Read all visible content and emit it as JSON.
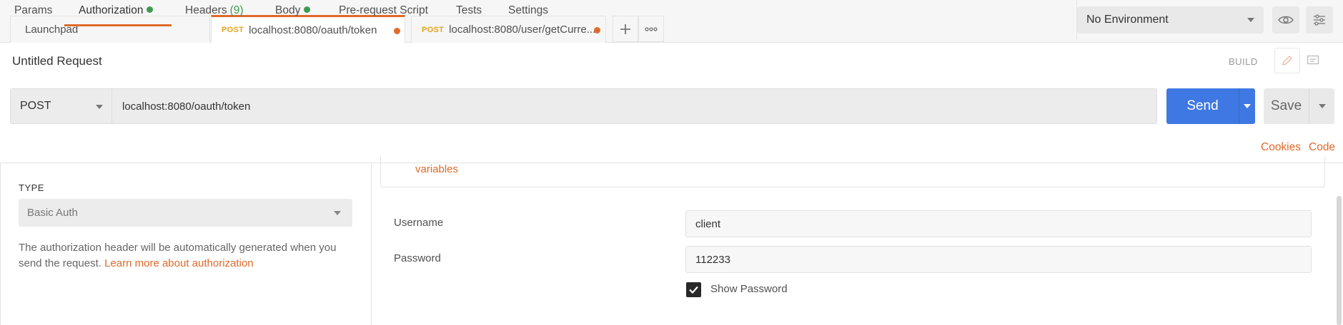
{
  "tabs": {
    "launchpad": "Launchpad",
    "tab1": {
      "method": "POST",
      "url": "localhost:8080/oauth/token"
    },
    "tab2": {
      "method": "POST",
      "url": "localhost:8080/user/getCurre..."
    },
    "add_icon": "plus-icon",
    "more_icon": "ellipsis-icon"
  },
  "environment": {
    "selected": "No Environment",
    "eye_icon": "eye-icon",
    "settings_icon": "sliders-icon"
  },
  "request": {
    "title": "Untitled Request",
    "build_label": "BUILD",
    "method": "POST",
    "url": "localhost:8080/oauth/token",
    "send_label": "Send",
    "save_label": "Save"
  },
  "request_tabs": {
    "params": "Params",
    "authorization": "Authorization",
    "headers": "Headers",
    "headers_count": "(9)",
    "body": "Body",
    "pre_request": "Pre-request Script",
    "tests": "Tests",
    "settings": "Settings",
    "cookies": "Cookies",
    "code": "Code"
  },
  "auth": {
    "type_label": "TYPE",
    "type_value": "Basic Auth",
    "description": "The authorization header will be automatically generated when you send the request. ",
    "learn_more": "Learn more about authorization",
    "variables_link": "variables",
    "username_label": "Username",
    "username_value": "client",
    "password_label": "Password",
    "password_value": "112233",
    "show_password_label": "Show Password",
    "show_password_checked": true
  },
  "colors": {
    "accent": "#e06a2a",
    "send": "#3f78e2",
    "status_green": "#3e9b4e"
  }
}
